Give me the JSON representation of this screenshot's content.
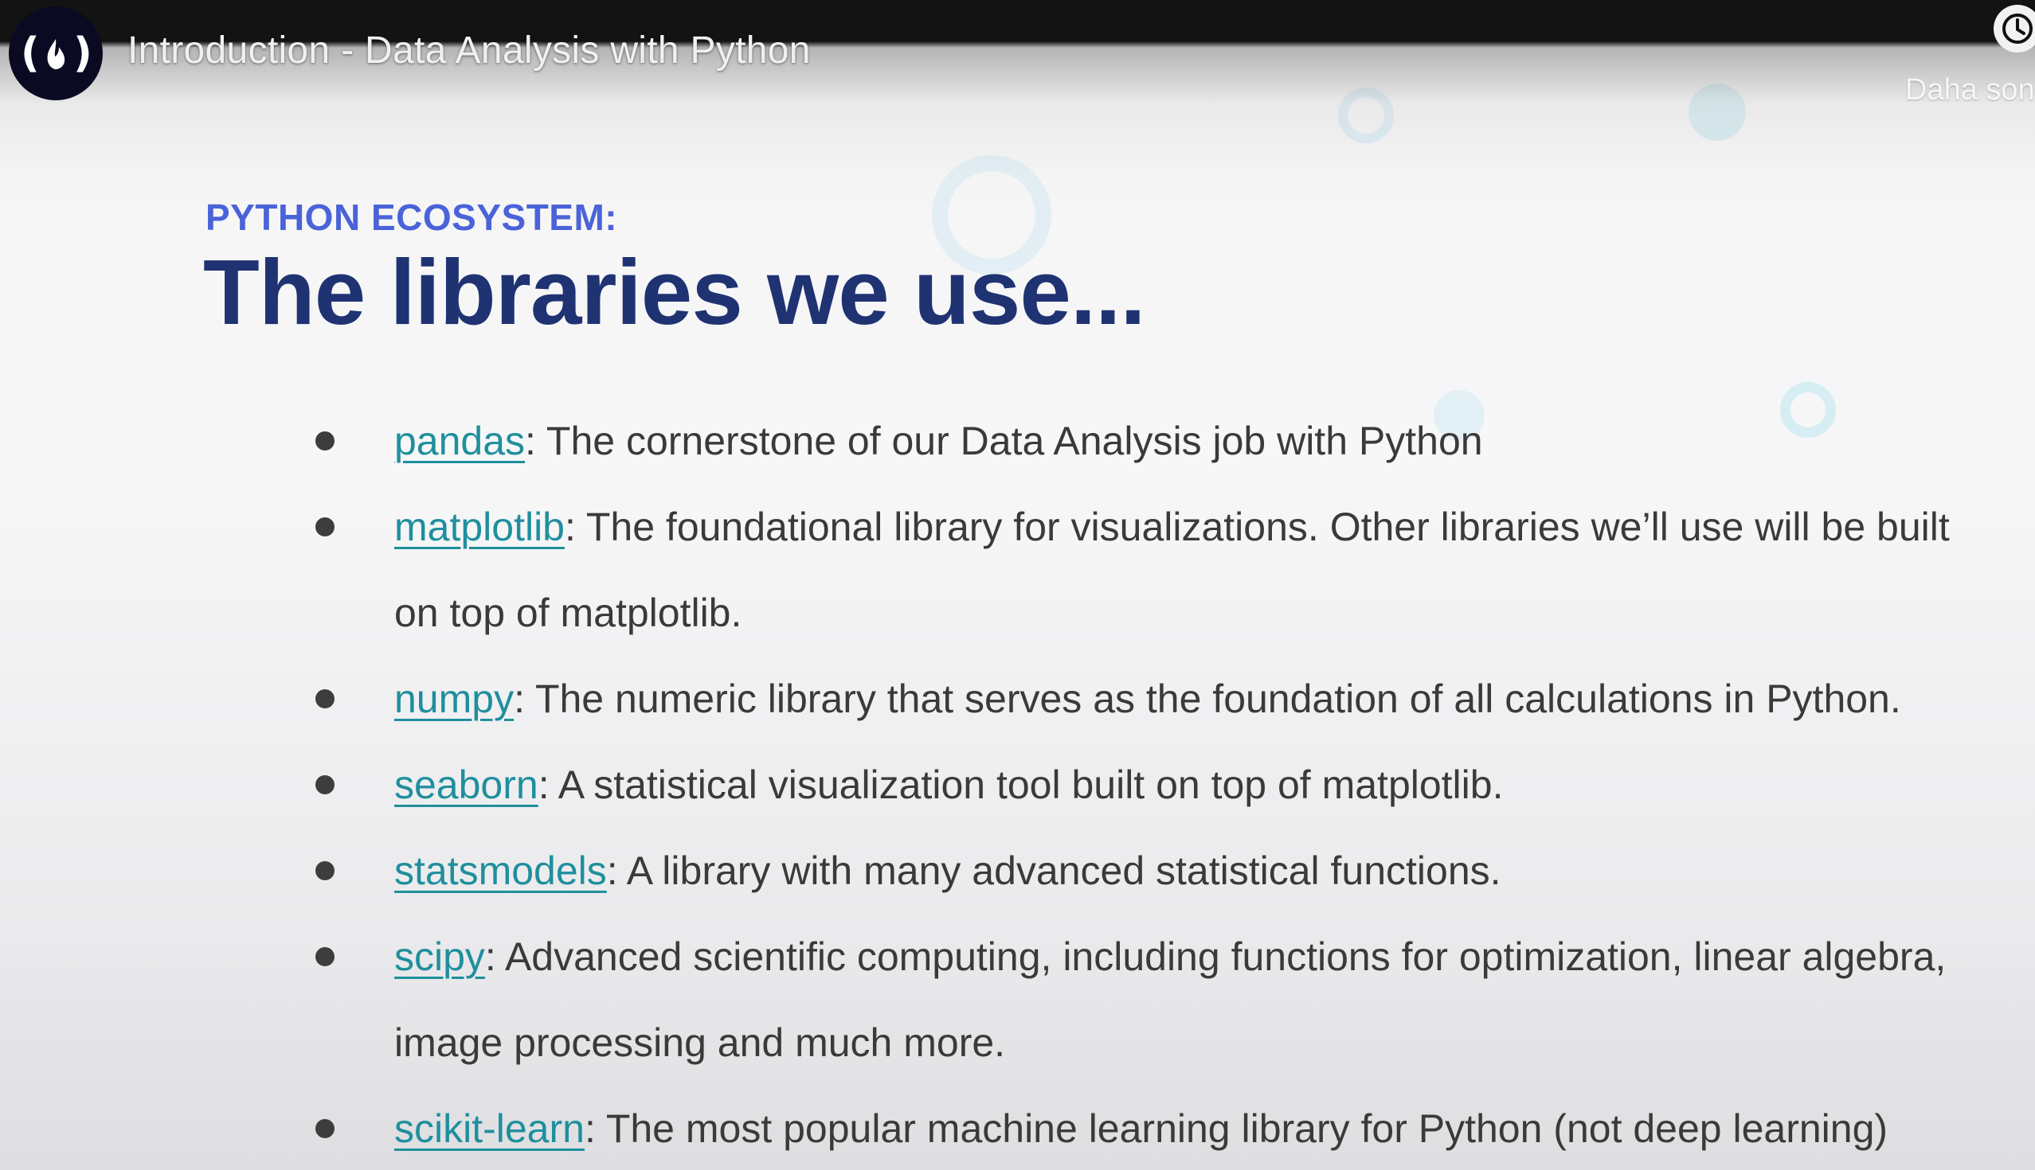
{
  "video": {
    "title": "Introduction - Data Analysis with Python",
    "watch_later_label": "Daha son"
  },
  "slide": {
    "kicker": "PYTHON ECOSYSTEM:",
    "heading": "The libraries we use...",
    "libraries": [
      {
        "name": "pandas",
        "description": ": The cornerstone of our Data Analysis job with Python"
      },
      {
        "name": "matplotlib",
        "description": ": The foundational library for visualizations. Other libraries we’ll use will be built on top of matplotlib."
      },
      {
        "name": "numpy",
        "description": ": The numeric library that serves as the foundation of all calculations in Python."
      },
      {
        "name": "seaborn",
        "description": ": A statistical visualization tool built on top of matplotlib."
      },
      {
        "name": "statsmodels",
        "description": ": A library with many advanced statistical functions."
      },
      {
        "name": "scipy",
        "description": ": Advanced scientific computing, including functions for optimization, linear algebra, image processing and much more."
      },
      {
        "name": "scikit-learn",
        "description": ": The most popular machine learning library for Python (not deep learning)"
      }
    ]
  },
  "colors": {
    "kicker": "#4a63d8",
    "heading": "#1f3373",
    "link": "#1f8f9d",
    "body_text": "#3a3a3a"
  },
  "icons": {
    "channel_logo": "freecodecamp-logo-icon",
    "watch_later": "clock-icon"
  }
}
